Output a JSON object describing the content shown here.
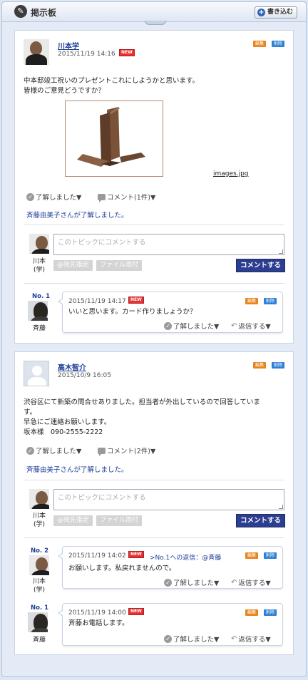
{
  "header": {
    "title": "掲示板",
    "write_button": "書き込む"
  },
  "topics": [
    {
      "author": "川本学",
      "date": "2015/11/19 14:16",
      "new_badge": "NEW",
      "edit_label": "編集",
      "delete_label": "削除",
      "body_lines": [
        "中本邸竣工祝いのプレゼントこれにしようかと思います。",
        "皆様のご意見どうですか？"
      ],
      "attachment": {
        "filename": "images.jpg"
      },
      "ack_button": "了解しました▼",
      "comment_button": "コメント(1件)▼",
      "ack_status": "斉藤由美子さんが了解しました。",
      "comment_form": {
        "user_name_line1": "川本",
        "user_name_line2": "(学)",
        "placeholder": "このトピックにコメントする",
        "recipient_button": "@宛先指定",
        "attach_button": "ファイル添付",
        "submit_button": "コメントする"
      },
      "replies": [
        {
          "no": "No. 1",
          "name": "斉藤",
          "date": "2015/11/19 14:17",
          "new_badge": "NEW",
          "edit_label": "編集",
          "delete_label": "削除",
          "text": "いいと思います。カード作りましょうか？",
          "ack_button": "了解しました▼",
          "reply_button": "返信する▼"
        }
      ]
    },
    {
      "author": "高木智介",
      "date": "2015/10/9 16:05",
      "edit_label": "編集",
      "delete_label": "削除",
      "body_lines": [
        "渋谷区にて新築の問合せありました。担当者が外出しているので回答していま",
        "す。",
        "早急にご連絡お願いします。",
        "坂本様　090-2555-2222"
      ],
      "ack_button": "了解しました▼",
      "comment_button": "コメント(2件)▼",
      "ack_status": "斉藤由美子さんが了解しました。",
      "comment_form": {
        "user_name_line1": "川本",
        "user_name_line2": "(学)",
        "placeholder": "このトピックにコメントする",
        "recipient_button": "@宛先指定",
        "attach_button": "ファイル添付",
        "submit_button": "コメントする"
      },
      "replies": [
        {
          "no": "No. 2",
          "name_line1": "川本",
          "name_line2": "(学)",
          "date": "2015/11/19 14:02",
          "new_badge": "NEW",
          "reply_ref": ">No.1への返信：@斉藤",
          "edit_label": "編集",
          "delete_label": "削除",
          "text": "お願いします。私戻れませんので。",
          "ack_button": "了解しました▼",
          "reply_button": "返信する▼"
        },
        {
          "no": "No. 1",
          "name": "斉藤",
          "date": "2015/11/19 14:00",
          "new_badge": "NEW",
          "edit_label": "編集",
          "delete_label": "削除",
          "text": "斉藤お電話します。",
          "ack_button": "了解しました▼",
          "reply_button": "返信する▼"
        }
      ]
    }
  ]
}
